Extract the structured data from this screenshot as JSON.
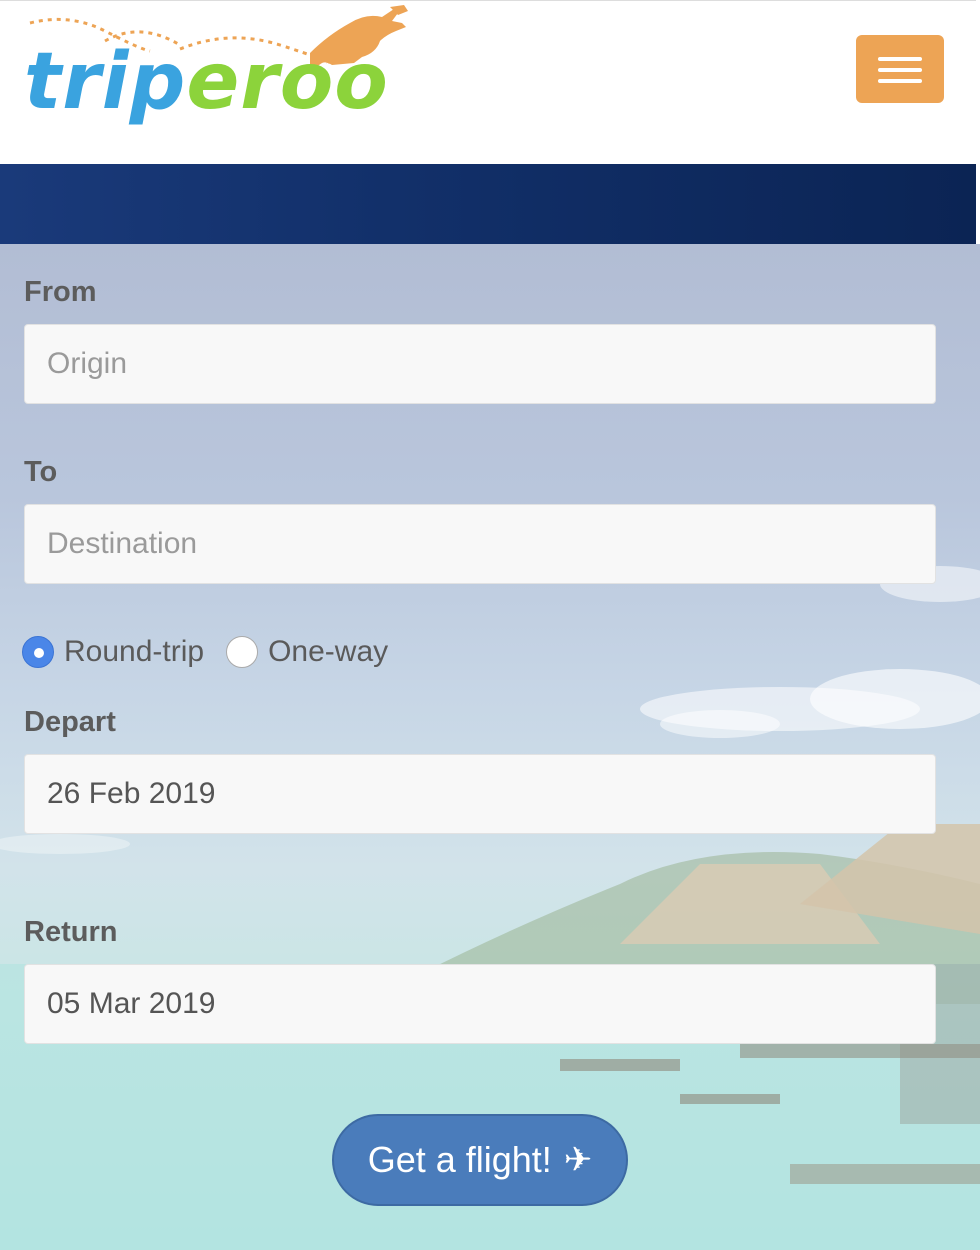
{
  "brand": {
    "logo_text_part1": "trip",
    "logo_text_part2": "eroo",
    "colors": {
      "blue": "#3aa3df",
      "green": "#8cd33b",
      "orange": "#eda455"
    }
  },
  "nav": {
    "menu_icon": "hamburger-icon"
  },
  "form": {
    "from": {
      "label": "From",
      "placeholder": "Origin"
    },
    "to": {
      "label": "To",
      "placeholder": "Destination"
    },
    "trip_type": {
      "options": [
        {
          "label": "Round-trip",
          "selected": true
        },
        {
          "label": "One-way",
          "selected": false
        }
      ]
    },
    "depart": {
      "label": "Depart",
      "value": "26 Feb 2019"
    },
    "return": {
      "label": "Return",
      "value": "05 Mar 2019"
    },
    "submit": {
      "label": "Get a flight!",
      "icon": "plane-icon"
    }
  }
}
